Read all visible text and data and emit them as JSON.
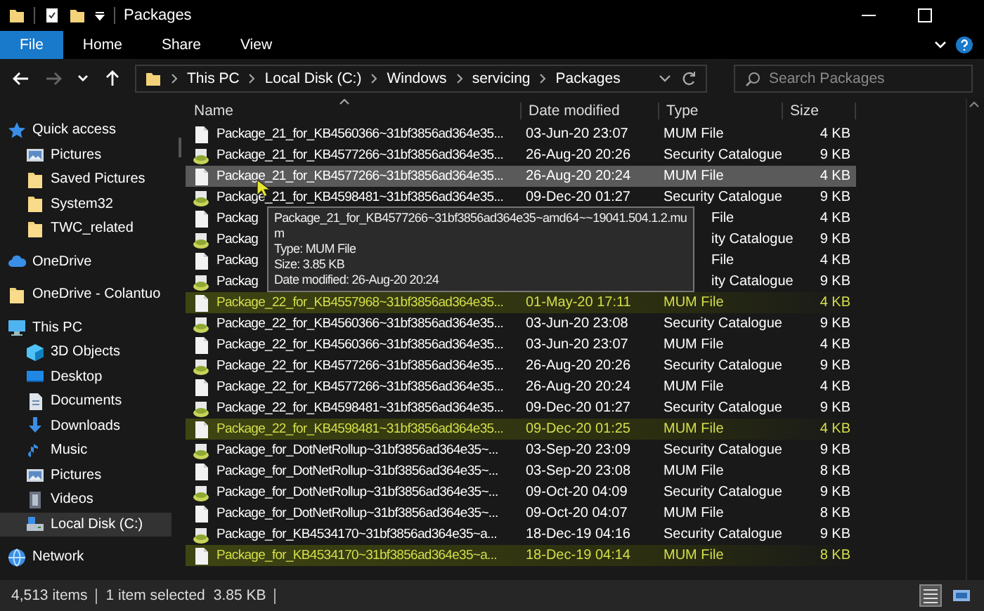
{
  "window": {
    "title": "Packages"
  },
  "ribbon": {
    "tabs": [
      {
        "label": "File",
        "kind": "menu",
        "selected": false
      },
      {
        "label": "Home",
        "kind": "tab",
        "selected": false
      },
      {
        "label": "Share",
        "kind": "tab",
        "selected": false
      },
      {
        "label": "View",
        "kind": "tab",
        "selected": false
      }
    ]
  },
  "navigation": [
    {
      "kind": "back",
      "disabled": false
    },
    {
      "kind": "forward",
      "disabled": true
    },
    {
      "kind": "recent",
      "disabled": false
    },
    {
      "kind": "up",
      "disabled": false
    }
  ],
  "address_bar": {
    "breadcrumbs": [
      "This PC",
      "Local Disk (C:)",
      "Windows",
      "servicing",
      "Packages"
    ]
  },
  "search": {
    "placeholder": "Search Packages"
  },
  "sidebar": {
    "items": [
      {
        "label": "Quick access",
        "kind": "star",
        "selected": false,
        "children": [
          {
            "label": "Pictures",
            "kind": "pictures",
            "selected": false
          },
          {
            "label": "Saved Pictures",
            "kind": "folder",
            "selected": false
          },
          {
            "label": "System32",
            "kind": "folder",
            "selected": false
          },
          {
            "label": "TWC_related",
            "kind": "folder",
            "selected": false
          }
        ]
      },
      {
        "label": "OneDrive",
        "kind": "cloud",
        "selected": false
      },
      {
        "label": "OneDrive - Colantuo",
        "kind": "folder",
        "selected": false
      },
      {
        "label": "This PC",
        "kind": "pc",
        "selected": false,
        "children": [
          {
            "label": "3D Objects",
            "kind": "cube",
            "selected": false
          },
          {
            "label": "Desktop",
            "kind": "desktop",
            "selected": false
          },
          {
            "label": "Documents",
            "kind": "documents",
            "selected": false
          },
          {
            "label": "Downloads",
            "kind": "download",
            "selected": false
          },
          {
            "label": "Music",
            "kind": "music",
            "selected": false
          },
          {
            "label": "Pictures",
            "kind": "pictures",
            "selected": false
          },
          {
            "label": "Videos",
            "kind": "videos",
            "selected": false
          },
          {
            "label": "Local Disk (C:)",
            "kind": "drive",
            "selected": true
          }
        ]
      },
      {
        "label": "Network",
        "kind": "network",
        "selected": false
      }
    ]
  },
  "file_list": {
    "columns": [
      {
        "label": "Name",
        "sorted": true
      },
      {
        "label": "Date modified",
        "sorted": false
      },
      {
        "label": "Type",
        "sorted": false
      },
      {
        "label": "Size",
        "sorted": false
      }
    ],
    "rows": [
      {
        "name": "Package_21_for_KB4560366~31bf3856ad364e35...",
        "date": "03-Jun-20 23:07",
        "type": "MUM File",
        "size": "4 KB",
        "kind": "file",
        "selected": false,
        "highlighted": false
      },
      {
        "name": "Package_21_for_KB4577266~31bf3856ad364e35...",
        "date": "26-Aug-20 20:26",
        "type": "Security Catalogue",
        "size": "9 KB",
        "kind": "catalog",
        "selected": false,
        "highlighted": false
      },
      {
        "name": "Package_21_for_KB4577266~31bf3856ad364e35...",
        "date": "26-Aug-20 20:24",
        "type": "MUM File",
        "size": "4 KB",
        "kind": "file",
        "selected": true,
        "highlighted": false
      },
      {
        "name": "Package_21_for_KB4598481~31bf3856ad364e35...",
        "date": "09-Dec-20 01:27",
        "type": "Security Catalogue",
        "size": "9 KB",
        "kind": "catalog",
        "selected": false,
        "highlighted": false
      },
      {
        "name": "Packag",
        "type": "File",
        "size": "4 KB",
        "kind": "file",
        "selected": false,
        "highlighted": false
      },
      {
        "name": "Packag",
        "type": "ity Catalogue",
        "size": "9 KB",
        "kind": "catalog",
        "selected": false,
        "highlighted": false
      },
      {
        "name": "Packag",
        "type": "File",
        "size": "4 KB",
        "kind": "file",
        "selected": false,
        "highlighted": false
      },
      {
        "name": "Packag",
        "type": "ity Catalogue",
        "size": "9 KB",
        "kind": "catalog",
        "selected": false,
        "highlighted": false
      },
      {
        "name": "Package_22_for_KB4557968~31bf3856ad364e35...",
        "date": "01-May-20 17:11",
        "type": "MUM File",
        "size": "4 KB",
        "kind": "file",
        "selected": false,
        "highlighted": true
      },
      {
        "name": "Package_22_for_KB4560366~31bf3856ad364e35...",
        "date": "03-Jun-20 23:08",
        "type": "Security Catalogue",
        "size": "9 KB",
        "kind": "catalog",
        "selected": false,
        "highlighted": false
      },
      {
        "name": "Package_22_for_KB4560366~31bf3856ad364e35...",
        "date": "03-Jun-20 23:07",
        "type": "MUM File",
        "size": "4 KB",
        "kind": "file",
        "selected": false,
        "highlighted": false
      },
      {
        "name": "Package_22_for_KB4577266~31bf3856ad364e35...",
        "date": "26-Aug-20 20:26",
        "type": "Security Catalogue",
        "size": "9 KB",
        "kind": "catalog",
        "selected": false,
        "highlighted": false
      },
      {
        "name": "Package_22_for_KB4577266~31bf3856ad364e35...",
        "date": "26-Aug-20 20:24",
        "type": "MUM File",
        "size": "4 KB",
        "kind": "file",
        "selected": false,
        "highlighted": false
      },
      {
        "name": "Package_22_for_KB4598481~31bf3856ad364e35...",
        "date": "09-Dec-20 01:27",
        "type": "Security Catalogue",
        "size": "9 KB",
        "kind": "catalog",
        "selected": false,
        "highlighted": false
      },
      {
        "name": "Package_22_for_KB4598481~31bf3856ad364e35...",
        "date": "09-Dec-20 01:25",
        "type": "MUM File",
        "size": "4 KB",
        "kind": "file",
        "selected": false,
        "highlighted": true
      },
      {
        "name": "Package_for_DotNetRollup~31bf3856ad364e35~...",
        "date": "03-Sep-20 23:09",
        "type": "Security Catalogue",
        "size": "9 KB",
        "kind": "catalog",
        "selected": false,
        "highlighted": false
      },
      {
        "name": "Package_for_DotNetRollup~31bf3856ad364e35~...",
        "date": "03-Sep-20 23:08",
        "type": "MUM File",
        "size": "8 KB",
        "kind": "file",
        "selected": false,
        "highlighted": false
      },
      {
        "name": "Package_for_DotNetRollup~31bf3856ad364e35~...",
        "date": "09-Oct-20 04:09",
        "type": "Security Catalogue",
        "size": "9 KB",
        "kind": "catalog",
        "selected": false,
        "highlighted": false
      },
      {
        "name": "Package_for_DotNetRollup~31bf3856ad364e35~...",
        "date": "09-Oct-20 04:07",
        "type": "MUM File",
        "size": "8 KB",
        "kind": "file",
        "selected": false,
        "highlighted": false
      },
      {
        "name": "Package_for_KB4534170~31bf3856ad364e35~a...",
        "date": "18-Dec-19 04:16",
        "type": "Security Catalogue",
        "size": "9 KB",
        "kind": "catalog",
        "selected": false,
        "highlighted": false
      },
      {
        "name": "Package_for_KB4534170~31bf3856ad364e35~a...",
        "date": "18-Dec-19 04:14",
        "type": "MUM File",
        "size": "8 KB",
        "kind": "file",
        "selected": false,
        "highlighted": true
      }
    ],
    "tooltip": {
      "lines": [
        "Package_21_for_KB4577266~31bf3856ad364e35~amd64~~19041.504.1.2.mu",
        "m",
        "Type: MUM File",
        "Size: 3.85 KB",
        "Date modified: 26-Aug-20 20:24"
      ]
    }
  },
  "status_bar": {
    "item_count": "4,513 items",
    "selection": "1 item selected",
    "selection_size": "3.85 KB",
    "views": [
      {
        "kind": "details",
        "selected": true
      },
      {
        "kind": "large_icons",
        "selected": false
      }
    ]
  }
}
